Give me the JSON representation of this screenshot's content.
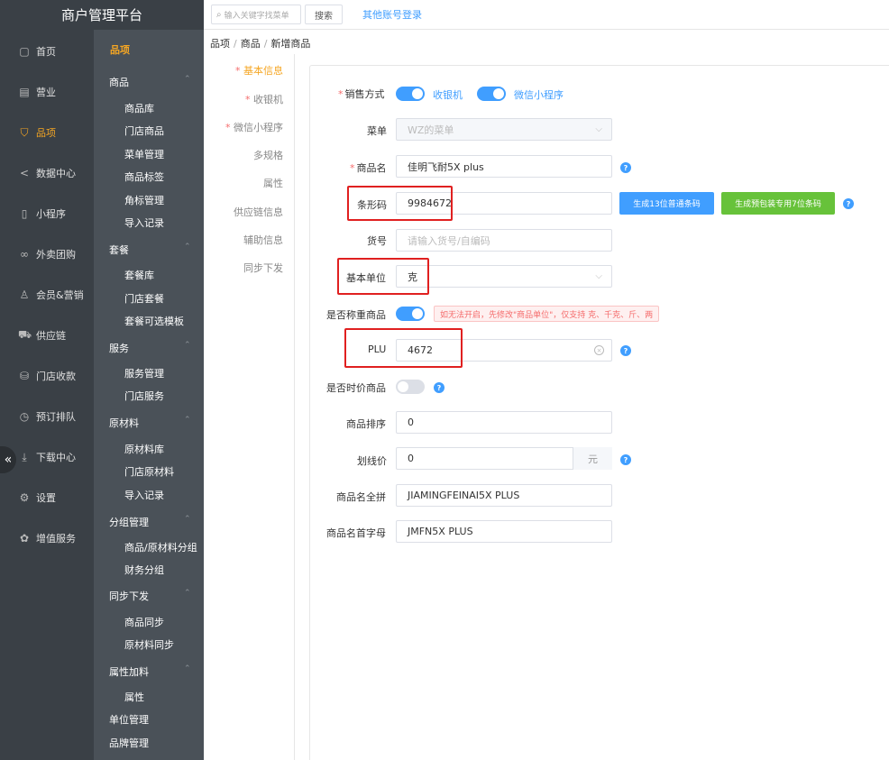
{
  "brand": "商户管理平台",
  "topbar": {
    "search_placeholder": "输入关键字找菜单",
    "search_button": "搜索",
    "other_login": "其他账号登录"
  },
  "nav1": [
    {
      "label": "首页",
      "icon": "file-icon"
    },
    {
      "label": "营业",
      "icon": "calendar-icon"
    },
    {
      "label": "品项",
      "icon": "bag-icon",
      "active": true
    },
    {
      "label": "数据中心",
      "icon": "share-icon"
    },
    {
      "label": "小程序",
      "icon": "phone-icon"
    },
    {
      "label": "外卖团购",
      "icon": "bike-icon"
    },
    {
      "label": "会员&营销",
      "icon": "user-icon"
    },
    {
      "label": "供应链",
      "icon": "truck-icon"
    },
    {
      "label": "门店收款",
      "icon": "database-icon"
    },
    {
      "label": "预订排队",
      "icon": "clock-icon"
    },
    {
      "label": "下载中心",
      "icon": "download-icon"
    },
    {
      "label": "设置",
      "icon": "gear-icon"
    },
    {
      "label": "增值服务",
      "icon": "gift-icon"
    }
  ],
  "nav2": {
    "title": "品项",
    "groups": [
      {
        "label": "商品",
        "items": [
          "商品库",
          "门店商品",
          "菜单管理",
          "商品标签",
          "角标管理",
          "导入记录"
        ]
      },
      {
        "label": "套餐",
        "items": [
          "套餐库",
          "门店套餐",
          "套餐可选模板"
        ]
      },
      {
        "label": "服务",
        "items": [
          "服务管理",
          "门店服务"
        ]
      },
      {
        "label": "原材料",
        "items": [
          "原材料库",
          "门店原材料",
          "导入记录"
        ]
      },
      {
        "label": "分组管理",
        "items": [
          "商品/原材料分组",
          "财务分组"
        ]
      },
      {
        "label": "同步下发",
        "items": [
          "商品同步",
          "原材料同步"
        ]
      },
      {
        "label": "属性加料",
        "items": [
          "属性"
        ]
      }
    ],
    "tail": [
      "单位管理",
      "品牌管理"
    ]
  },
  "breadcrumb": [
    "品项",
    "商品",
    "新增商品"
  ],
  "vtabs": [
    {
      "label": "基本信息",
      "required": true,
      "active": true
    },
    {
      "label": "收银机",
      "required": true
    },
    {
      "label": "微信小程序",
      "required": true
    },
    {
      "label": "多规格"
    },
    {
      "label": "属性"
    },
    {
      "label": "供应链信息"
    },
    {
      "label": "辅助信息"
    },
    {
      "label": "同步下发"
    }
  ],
  "form": {
    "sales_mode_label": "销售方式",
    "sales_pos": "收银机",
    "sales_wechat": "微信小程序",
    "menu_label": "菜单",
    "menu_value": "WZ的菜单",
    "name_label": "商品名",
    "name_value": "佳明飞耐5X plus",
    "barcode_label": "条形码",
    "barcode_value": "9984672",
    "gen13_button": "生成13位普通条码",
    "gen7_button": "生成预包装专用7位条码",
    "sku_label": "货号",
    "sku_placeholder": "请输入货号/自编码",
    "unit_label": "基本单位",
    "unit_value": "克",
    "weighed_label": "是否称重商品",
    "weighed_warning": "如无法开启，先修改\"商品单位\"，仅支持 克、千克、斤、两",
    "plu_label": "PLU",
    "plu_value": "4672",
    "seasonal_label": "是否时价商品",
    "sort_label": "商品排序",
    "sort_value": "0",
    "strike_label": "划线价",
    "strike_value": "0",
    "strike_unit": "元",
    "pinyin_label": "商品名全拼",
    "pinyin_value": "JIAMINGFEINAI5X PLUS",
    "initials_label": "商品名首字母",
    "initials_value": "JMFN5X PLUS"
  },
  "colors": {
    "accent": "#f5a623",
    "primary": "#409eff",
    "success": "#67c23a",
    "danger": "#f56c6c",
    "sidebar_dark": "#3a4046",
    "sidebar_mid": "#4a5158"
  }
}
